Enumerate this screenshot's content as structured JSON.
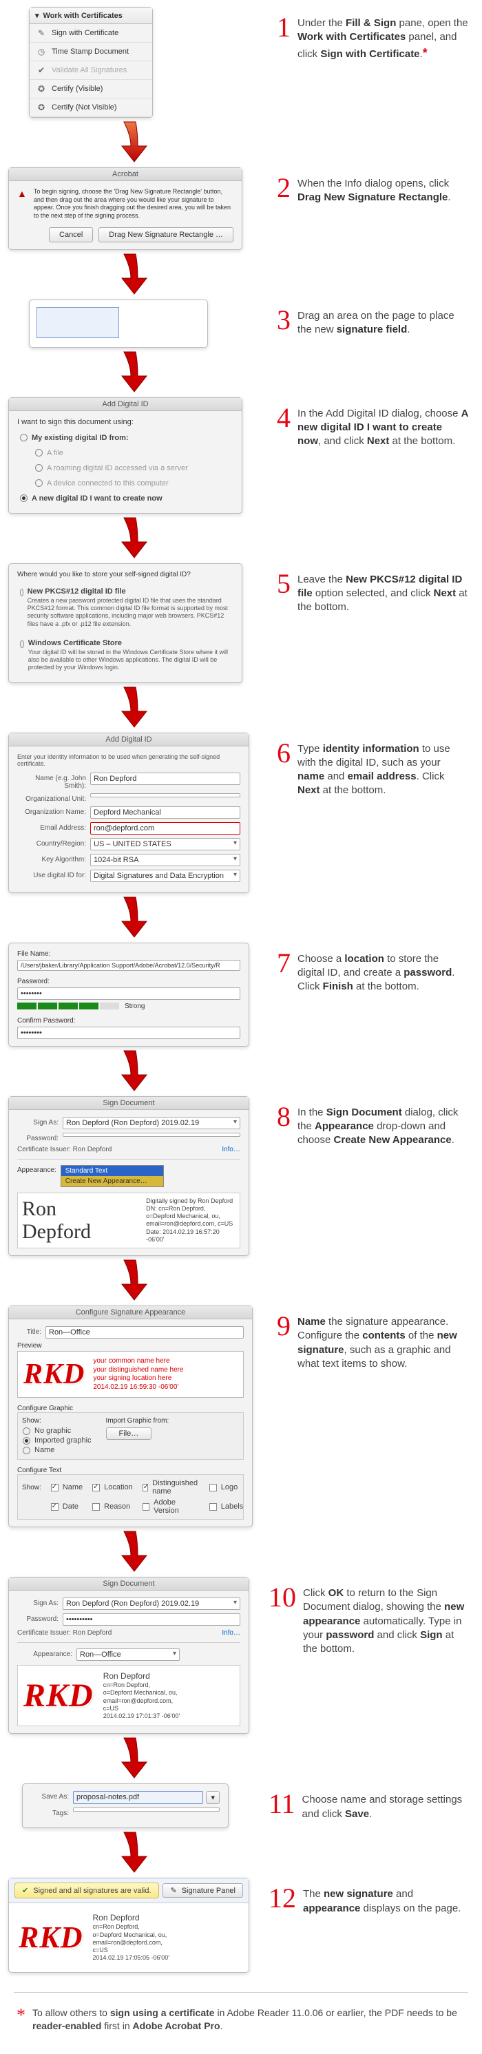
{
  "step1": {
    "num": "1",
    "text_before": "Under the ",
    "b1": "Fill & Sign",
    "mid1": " pane, open the ",
    "b2": "Work with Certificates",
    "mid2": " panel, and click ",
    "b3": "Sign with Certificate",
    "end": ".",
    "panel_title": "Work with Certificates",
    "items": {
      "sign": "Sign with Certificate",
      "timestamp": "Time Stamp Document",
      "validate": "Validate All Signatures",
      "certify_vis": "Certify (Visible)",
      "certify_invis": "Certify (Not Visible)"
    }
  },
  "step2": {
    "num": "2",
    "pre": "When the Info dialog opens, click ",
    "b": "Drag New Signature Rectangle",
    "end": ".",
    "panel_title": "Acrobat",
    "dialog_text": "To begin signing, choose the 'Drag New Signature Rectangle' button, and then drag out the area where you would like your signature to appear. Once you finish dragging out the desired area, you will be taken to the next step of the signing process.",
    "btn_cancel": "Cancel",
    "btn_drag": "Drag New Signature Rectangle …"
  },
  "step3": {
    "num": "3",
    "pre": "Drag an area on the page to place the new ",
    "b": "signature field",
    "end": "."
  },
  "step4": {
    "num": "4",
    "pre": "In the Add Digital ID dialog, choose ",
    "b1": "A new digital ID I want to create now",
    "mid": ", and click ",
    "b2": "Next",
    "end": " at the bottom.",
    "panel_title": "Add Digital ID",
    "lead": "I want to sign this document using:",
    "opt_existing": "My existing digital ID from:",
    "opt_file": "A file",
    "opt_roaming": "A roaming digital ID accessed via a server",
    "opt_device": "A device connected to this computer",
    "opt_new": "A new digital ID I want to create now"
  },
  "step5": {
    "num": "5",
    "pre": "Leave the ",
    "b1": "New PKCS#12 digital ID file",
    "mid": " option selected, and click ",
    "b2": "Next",
    "end": " at the bottom.",
    "lead": "Where would you like to store your self-signed digital ID?",
    "opt_pkcs_title": "New PKCS#12 digital ID file",
    "opt_pkcs_desc": "Creates a new password protected digital ID file that uses the standard PKCS#12 format. This common digital ID file format is supported by most security software applications, including major web browsers. PKCS#12 files have a .pfx or .p12 file extension.",
    "opt_win_title": "Windows Certificate Store",
    "opt_win_desc": "Your digital ID will be stored in the Windows Certificate Store where it will also be available to other Windows applications. The digital ID will be protected by your Windows login."
  },
  "step6": {
    "num": "6",
    "pre": "Type ",
    "b1": "identity information",
    "mid1": " to use with the digital ID, such as your ",
    "b2": "name",
    "mid2": " and ",
    "b3": "email address",
    "mid3": ". Click ",
    "b4": "Next",
    "end": " at the bottom.",
    "panel_title": "Add Digital ID",
    "lead": "Enter your identity information to be used when generating the self-signed certificate.",
    "lab_name": "Name (e.g. John Smith):",
    "val_name": "Ron Depford",
    "lab_orgunit": "Organizational Unit:",
    "val_orgunit": "",
    "lab_org": "Organization Name:",
    "val_org": "Depford Mechanical",
    "lab_email": "Email Address:",
    "val_email": "ron@depford.com",
    "lab_country": "Country/Region:",
    "val_country": "US – UNITED STATES",
    "lab_keyalg": "Key Algorithm:",
    "val_keyalg": "1024-bit RSA",
    "lab_use": "Use digital ID for:",
    "val_use": "Digital Signatures and Data Encryption"
  },
  "step7": {
    "num": "7",
    "pre": "Choose a ",
    "b1": "location",
    "mid1": " to store the digital ID, and create a ",
    "b2": "password",
    "mid2": ". Click ",
    "b3": "Finish",
    "end": " at the bottom.",
    "lab_file": "File Name:",
    "val_file": "/Users/jbaker/Library/Application Support/Adobe/Acrobat/12.0/Security/R",
    "lab_pass": "Password:",
    "val_pass": "••••••••",
    "strength": "Strong",
    "lab_confirm": "Confirm Password:",
    "val_confirm": "••••••••"
  },
  "step8": {
    "num": "8",
    "pre": "In the ",
    "b1": "Sign Document",
    "mid1": " dialog, click the ",
    "b2": "Appearance",
    "mid2": " drop-down and choose ",
    "b3": "Create New Appearance",
    "end": ".",
    "panel_title": "Sign Document",
    "lab_signas": "Sign As:",
    "val_signas": "Ron Depford (Ron Depford) 2019.02.19",
    "lab_pass": "Password:",
    "val_pass": "",
    "issuer": "Certificate Issuer: Ron Depford",
    "info_link": "Info…",
    "lab_appearance": "Appearance:",
    "appearance_opt1": "Standard Text",
    "appearance_opt2": "Create New Appearance…",
    "preview_name": "Ron Depford",
    "preview_details1": "Digitally signed by Ron Depford",
    "preview_details2": "DN: cn=Ron Depford, o=Depford Mechanical, ou,",
    "preview_details3": "email=ron@depford.com, c=US",
    "preview_details4": "Date: 2014.02.19 16:57:20 -06'00'"
  },
  "step9": {
    "num": "9",
    "b1": "Name",
    "mid1": " the signature appearance. Configure the ",
    "b2": "contents",
    "mid2": " of the ",
    "b3": "new signature",
    "end": ", such as a graphic and what text items to show.",
    "panel_title": "Configure Signature Appearance",
    "lab_title": "Title:",
    "val_title": "Ron—Office",
    "preview_label": "Preview",
    "preview_rkd": "RKD",
    "preview_line1": "your common name here",
    "preview_line2": "your distinguished name here",
    "preview_line3": "your signing location here",
    "preview_line4": "2014.02.19 16:59:30 -06'00'",
    "cfg_graphic": "Configure Graphic",
    "show_label": "Show:",
    "opt_no_graphic": "No graphic",
    "opt_imported": "Imported graphic",
    "opt_name": "Name",
    "imp_from": "Import Graphic from:",
    "btn_file": "File…",
    "cfg_text": "Configure Text",
    "c_name": "Name",
    "c_location": "Location",
    "c_dn": "Distinguished name",
    "c_logo": "Logo",
    "c_date": "Date",
    "c_reason": "Reason",
    "c_adobe": "Adobe Version",
    "c_labels": "Labels"
  },
  "step10": {
    "num": "10",
    "pre": "Click ",
    "b1": "OK",
    "mid1": " to return to the Sign Document dialog, showing the ",
    "b2": "new appearance",
    "mid2": " automatically. Type in your ",
    "b3": "password",
    "mid3": " and click ",
    "b4": "Sign",
    "end": " at the bottom.",
    "panel_title": "Sign Document",
    "lab_signas": "Sign As:",
    "val_signas": "Ron Depford (Ron Depford) 2019.02.19",
    "lab_pass": "Password:",
    "val_pass": "••••••••••",
    "issuer": "Certificate Issuer: Ron Depford",
    "info_link": "Info…",
    "lab_appearance": "Appearance:",
    "val_appearance": "Ron—Office",
    "preview_rkd": "RKD",
    "preview_name": "Ron Depford",
    "preview_l1": "cn=Ron Depford,",
    "preview_l2": "o=Depford Mechanical, ou,",
    "preview_l3": "email=ron@depford.com,",
    "preview_l4": "c=US",
    "preview_l5": "2014.02.19 17:01:37 -06'00'"
  },
  "step11": {
    "num": "11",
    "pre": "Choose name and storage settings and click ",
    "b": "Save",
    "end": ".",
    "lab_saveas": "Save As:",
    "val_saveas": "proposal-notes.pdf",
    "lab_tags": "Tags:"
  },
  "step12": {
    "num": "12",
    "pre": "The ",
    "b1": "new signature",
    "mid": " and ",
    "b2": "appearance",
    "end": " displays on the page.",
    "ribbon_text": "Signed and all signatures are valid.",
    "sigpanel_btn": "Signature Panel",
    "preview_rkd": "RKD",
    "preview_name": "Ron Depford",
    "preview_l1": "cn=Ron Depford,",
    "preview_l2": "o=Depford Mechanical, ou,",
    "preview_l3": "email=ron@depford.com,",
    "preview_l4": "c=US",
    "preview_l5": "2014.02.19 17:05:05 -06'00'"
  },
  "footnote": {
    "star": "*",
    "pre": "To allow others to ",
    "b1": "sign using a certificate",
    "mid1": " in Adobe Reader 11.0.06 or earlier, the PDF needs to be ",
    "b2": "reader-enabled",
    "mid2": " first in ",
    "b3": "Adobe Acrobat Pro",
    "end": "."
  }
}
